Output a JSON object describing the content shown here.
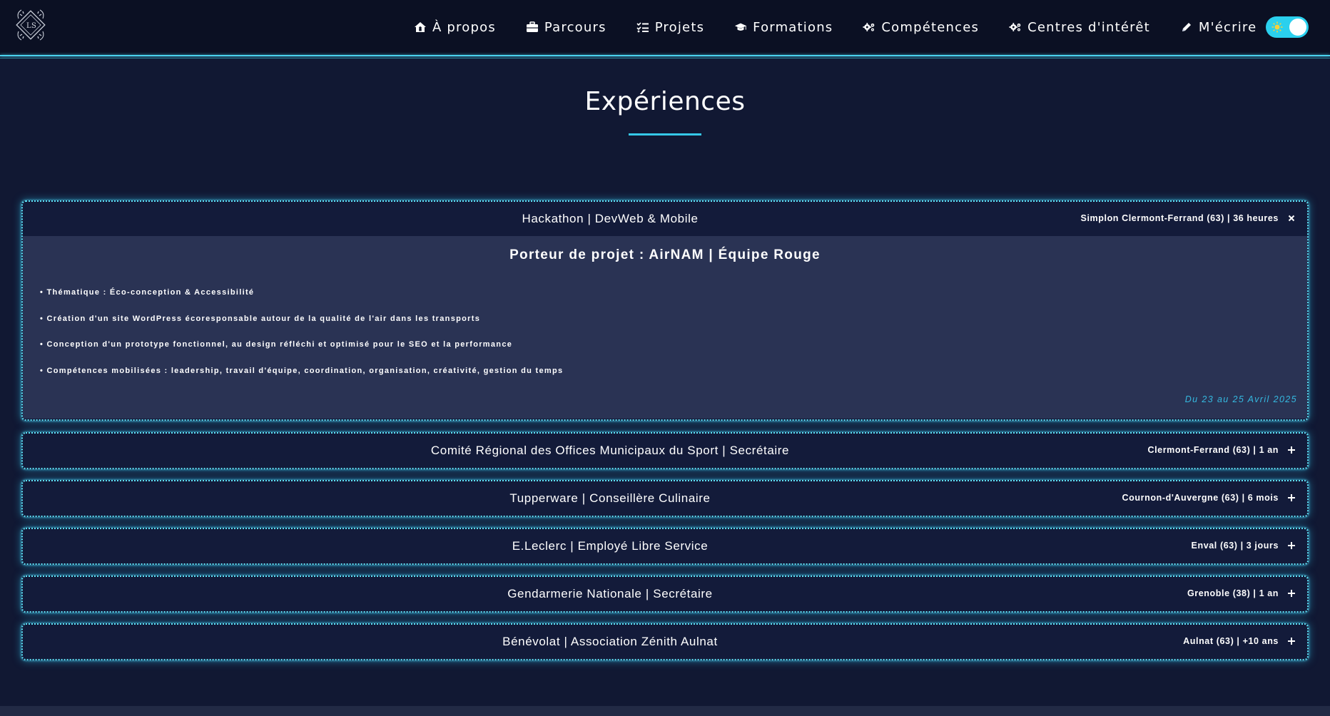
{
  "navbar": {
    "items": [
      {
        "label": "À propos",
        "icon": "home-icon"
      },
      {
        "label": "Parcours",
        "icon": "briefcase-icon"
      },
      {
        "label": "Projets",
        "icon": "checklist-icon"
      },
      {
        "label": "Formations",
        "icon": "graduation-cap-icon"
      },
      {
        "label": "Compétences",
        "icon": "gears-icon"
      },
      {
        "label": "Centres d'intérêt",
        "icon": "gears-icon"
      },
      {
        "label": "M'écrire",
        "icon": "pencil-icon"
      }
    ],
    "theme_toggle": {
      "state": "on",
      "icon": "sun-icon"
    },
    "accent_color": "#4ad3ee"
  },
  "section": {
    "title": "Expériences"
  },
  "experiences": [
    {
      "title": "Hackathon | DevWeb & Mobile",
      "meta": "Simplon Clermont-Ferrand (63) | 36 heures",
      "expanded": true,
      "toggle_icon": "close-icon",
      "heading": "Porteur de projet : AirNAM | Équipe Rouge",
      "bullets": [
        "• Thématique : Éco-conception & Accessibilité",
        "• Création d'un site WordPress écoresponsable autour de la qualité de l'air dans les transports",
        "• Conception d'un prototype fonctionnel, au design réfléchi et optimisé pour le SEO et la performance",
        "• Compétences mobilisées : leadership, travail d'équipe, coordination, organisation, créativité, gestion du temps"
      ],
      "date": "Du 23 au 25 Avril 2025"
    },
    {
      "title": "Comité Régional des Offices Municipaux du Sport | Secrétaire",
      "meta": "Clermont-Ferrand (63) | 1 an",
      "expanded": false,
      "toggle_icon": "plus-icon"
    },
    {
      "title": "Tupperware | Conseillère Culinaire",
      "meta": "Cournon-d'Auvergne (63) | 6 mois",
      "expanded": false,
      "toggle_icon": "plus-icon"
    },
    {
      "title": "E.Leclerc | Employé Libre Service",
      "meta": "Enval (63) | 3 jours",
      "expanded": false,
      "toggle_icon": "plus-icon"
    },
    {
      "title": "Gendarmerie Nationale | Secrétaire",
      "meta": "Grenoble (38) | 1 an",
      "expanded": false,
      "toggle_icon": "plus-icon"
    },
    {
      "title": "Bénévolat | Association Zénith Aulnat",
      "meta": "Aulnat (63) | +10 ans",
      "expanded": false,
      "toggle_icon": "plus-icon"
    }
  ]
}
